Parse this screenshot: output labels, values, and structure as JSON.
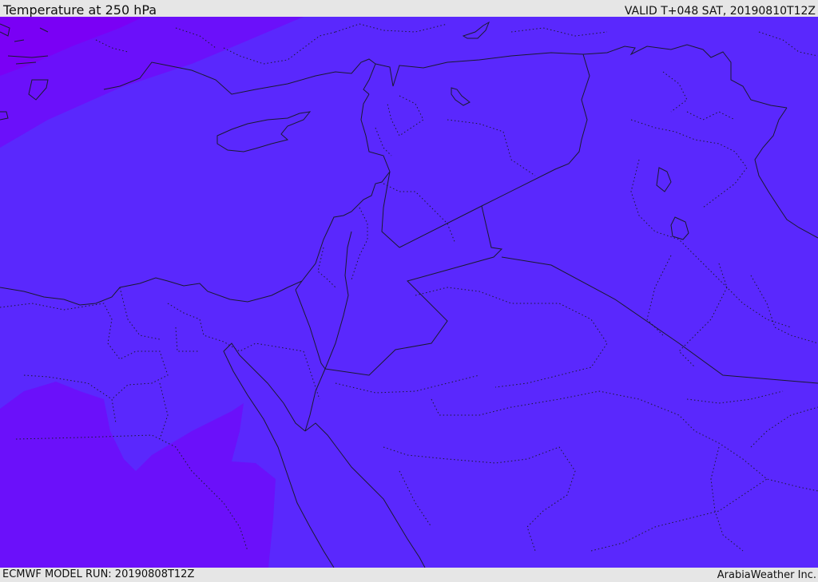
{
  "header": {
    "title": "Temperature at 250 hPa",
    "valid_time": "VALID T+048 SAT, 20190810T12Z"
  },
  "footer": {
    "model_run": "ECMWF MODEL RUN: 20190808T12Z",
    "credit": "ArabiaWeather Inc."
  },
  "map": {
    "field": "temperature",
    "level_hpa": 250,
    "colors": {
      "base_fill": "#5a28fd",
      "warm_fill": "#6b10fa",
      "coldest_fill": "#7a00f5",
      "border_line": "#1a1a30"
    }
  }
}
